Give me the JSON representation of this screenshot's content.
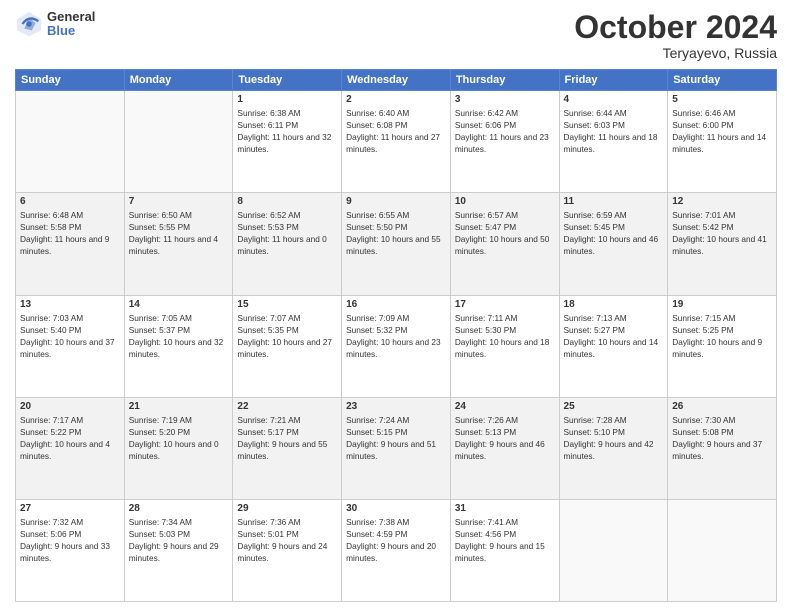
{
  "logo": {
    "general": "General",
    "blue": "Blue"
  },
  "title": "October 2024",
  "location": "Teryayevo, Russia",
  "days_of_week": [
    "Sunday",
    "Monday",
    "Tuesday",
    "Wednesday",
    "Thursday",
    "Friday",
    "Saturday"
  ],
  "weeks": [
    [
      {
        "day": "",
        "info": ""
      },
      {
        "day": "",
        "info": ""
      },
      {
        "day": "1",
        "sunrise": "Sunrise: 6:38 AM",
        "sunset": "Sunset: 6:11 PM",
        "daylight": "Daylight: 11 hours and 32 minutes."
      },
      {
        "day": "2",
        "sunrise": "Sunrise: 6:40 AM",
        "sunset": "Sunset: 6:08 PM",
        "daylight": "Daylight: 11 hours and 27 minutes."
      },
      {
        "day": "3",
        "sunrise": "Sunrise: 6:42 AM",
        "sunset": "Sunset: 6:06 PM",
        "daylight": "Daylight: 11 hours and 23 minutes."
      },
      {
        "day": "4",
        "sunrise": "Sunrise: 6:44 AM",
        "sunset": "Sunset: 6:03 PM",
        "daylight": "Daylight: 11 hours and 18 minutes."
      },
      {
        "day": "5",
        "sunrise": "Sunrise: 6:46 AM",
        "sunset": "Sunset: 6:00 PM",
        "daylight": "Daylight: 11 hours and 14 minutes."
      }
    ],
    [
      {
        "day": "6",
        "sunrise": "Sunrise: 6:48 AM",
        "sunset": "Sunset: 5:58 PM",
        "daylight": "Daylight: 11 hours and 9 minutes."
      },
      {
        "day": "7",
        "sunrise": "Sunrise: 6:50 AM",
        "sunset": "Sunset: 5:55 PM",
        "daylight": "Daylight: 11 hours and 4 minutes."
      },
      {
        "day": "8",
        "sunrise": "Sunrise: 6:52 AM",
        "sunset": "Sunset: 5:53 PM",
        "daylight": "Daylight: 11 hours and 0 minutes."
      },
      {
        "day": "9",
        "sunrise": "Sunrise: 6:55 AM",
        "sunset": "Sunset: 5:50 PM",
        "daylight": "Daylight: 10 hours and 55 minutes."
      },
      {
        "day": "10",
        "sunrise": "Sunrise: 6:57 AM",
        "sunset": "Sunset: 5:47 PM",
        "daylight": "Daylight: 10 hours and 50 minutes."
      },
      {
        "day": "11",
        "sunrise": "Sunrise: 6:59 AM",
        "sunset": "Sunset: 5:45 PM",
        "daylight": "Daylight: 10 hours and 46 minutes."
      },
      {
        "day": "12",
        "sunrise": "Sunrise: 7:01 AM",
        "sunset": "Sunset: 5:42 PM",
        "daylight": "Daylight: 10 hours and 41 minutes."
      }
    ],
    [
      {
        "day": "13",
        "sunrise": "Sunrise: 7:03 AM",
        "sunset": "Sunset: 5:40 PM",
        "daylight": "Daylight: 10 hours and 37 minutes."
      },
      {
        "day": "14",
        "sunrise": "Sunrise: 7:05 AM",
        "sunset": "Sunset: 5:37 PM",
        "daylight": "Daylight: 10 hours and 32 minutes."
      },
      {
        "day": "15",
        "sunrise": "Sunrise: 7:07 AM",
        "sunset": "Sunset: 5:35 PM",
        "daylight": "Daylight: 10 hours and 27 minutes."
      },
      {
        "day": "16",
        "sunrise": "Sunrise: 7:09 AM",
        "sunset": "Sunset: 5:32 PM",
        "daylight": "Daylight: 10 hours and 23 minutes."
      },
      {
        "day": "17",
        "sunrise": "Sunrise: 7:11 AM",
        "sunset": "Sunset: 5:30 PM",
        "daylight": "Daylight: 10 hours and 18 minutes."
      },
      {
        "day": "18",
        "sunrise": "Sunrise: 7:13 AM",
        "sunset": "Sunset: 5:27 PM",
        "daylight": "Daylight: 10 hours and 14 minutes."
      },
      {
        "day": "19",
        "sunrise": "Sunrise: 7:15 AM",
        "sunset": "Sunset: 5:25 PM",
        "daylight": "Daylight: 10 hours and 9 minutes."
      }
    ],
    [
      {
        "day": "20",
        "sunrise": "Sunrise: 7:17 AM",
        "sunset": "Sunset: 5:22 PM",
        "daylight": "Daylight: 10 hours and 4 minutes."
      },
      {
        "day": "21",
        "sunrise": "Sunrise: 7:19 AM",
        "sunset": "Sunset: 5:20 PM",
        "daylight": "Daylight: 10 hours and 0 minutes."
      },
      {
        "day": "22",
        "sunrise": "Sunrise: 7:21 AM",
        "sunset": "Sunset: 5:17 PM",
        "daylight": "Daylight: 9 hours and 55 minutes."
      },
      {
        "day": "23",
        "sunrise": "Sunrise: 7:24 AM",
        "sunset": "Sunset: 5:15 PM",
        "daylight": "Daylight: 9 hours and 51 minutes."
      },
      {
        "day": "24",
        "sunrise": "Sunrise: 7:26 AM",
        "sunset": "Sunset: 5:13 PM",
        "daylight": "Daylight: 9 hours and 46 minutes."
      },
      {
        "day": "25",
        "sunrise": "Sunrise: 7:28 AM",
        "sunset": "Sunset: 5:10 PM",
        "daylight": "Daylight: 9 hours and 42 minutes."
      },
      {
        "day": "26",
        "sunrise": "Sunrise: 7:30 AM",
        "sunset": "Sunset: 5:08 PM",
        "daylight": "Daylight: 9 hours and 37 minutes."
      }
    ],
    [
      {
        "day": "27",
        "sunrise": "Sunrise: 7:32 AM",
        "sunset": "Sunset: 5:06 PM",
        "daylight": "Daylight: 9 hours and 33 minutes."
      },
      {
        "day": "28",
        "sunrise": "Sunrise: 7:34 AM",
        "sunset": "Sunset: 5:03 PM",
        "daylight": "Daylight: 9 hours and 29 minutes."
      },
      {
        "day": "29",
        "sunrise": "Sunrise: 7:36 AM",
        "sunset": "Sunset: 5:01 PM",
        "daylight": "Daylight: 9 hours and 24 minutes."
      },
      {
        "day": "30",
        "sunrise": "Sunrise: 7:38 AM",
        "sunset": "Sunset: 4:59 PM",
        "daylight": "Daylight: 9 hours and 20 minutes."
      },
      {
        "day": "31",
        "sunrise": "Sunrise: 7:41 AM",
        "sunset": "Sunset: 4:56 PM",
        "daylight": "Daylight: 9 hours and 15 minutes."
      },
      {
        "day": "",
        "info": ""
      },
      {
        "day": "",
        "info": ""
      }
    ]
  ]
}
